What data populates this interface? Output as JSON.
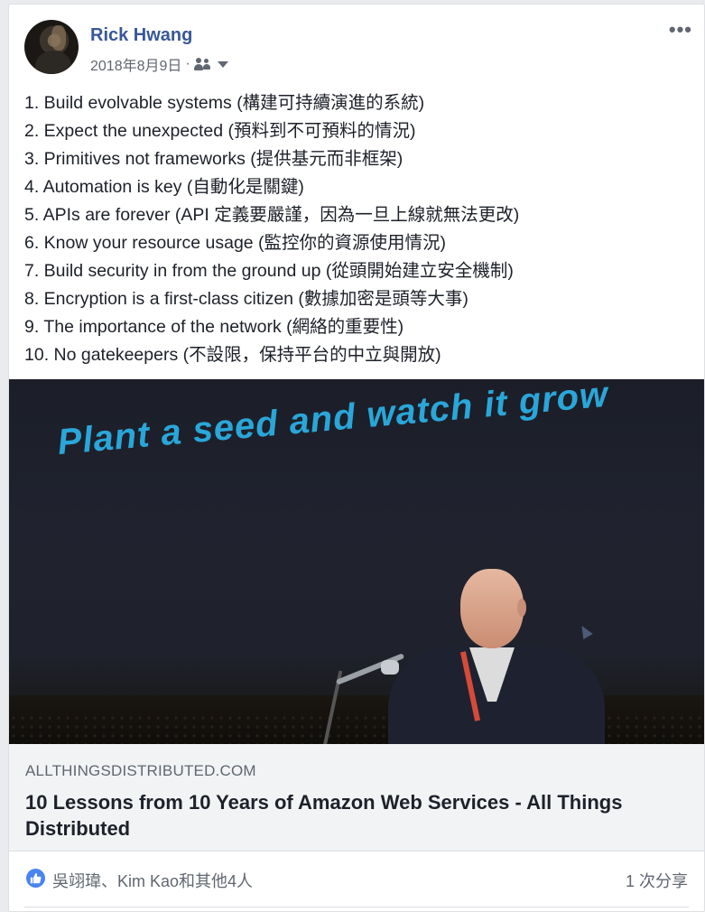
{
  "post": {
    "author": "Rick Hwang",
    "date": "2018年8月9日",
    "separator": "·",
    "menu_icon": "more-horizontal-icon",
    "audience_icon": "friends-icon",
    "lines": [
      "1. Build evolvable systems (構建可持續演進的系統)",
      "2. Expect the unexpected (預料到不可預料的情況)",
      "3. Primitives not frameworks (提供基元而非框架)",
      "4. Automation is key (自動化是關鍵)",
      "5. APIs are forever (API 定義要嚴謹，因為一旦上線就無法更改)",
      "6. Know your resource usage (監控你的資源使用情況)",
      "7. Build security in from the ground up (從頭開始建立安全機制)",
      "8. Encryption is a first-class citizen (數據加密是頭等大事)",
      "9. The importance of the network (網絡的重要性)",
      "10. No gatekeepers (不設限，保持平台的中立與開放)"
    ]
  },
  "link": {
    "image_slide_text": "Plant a seed and watch it grow",
    "domain": "ALLTHINGSDISTRIBUTED.COM",
    "title": "10 Lessons from 10 Years of Amazon Web Services - All Things Distributed"
  },
  "footer": {
    "reaction_icon": "like-icon",
    "reactors": "吳翊瑋、Kim Kao和其他4人",
    "shares": "1 次分享"
  },
  "colors": {
    "author_link": "#385898",
    "like_blue": "#4a84f3",
    "slide_text": "#2aa6d8"
  }
}
